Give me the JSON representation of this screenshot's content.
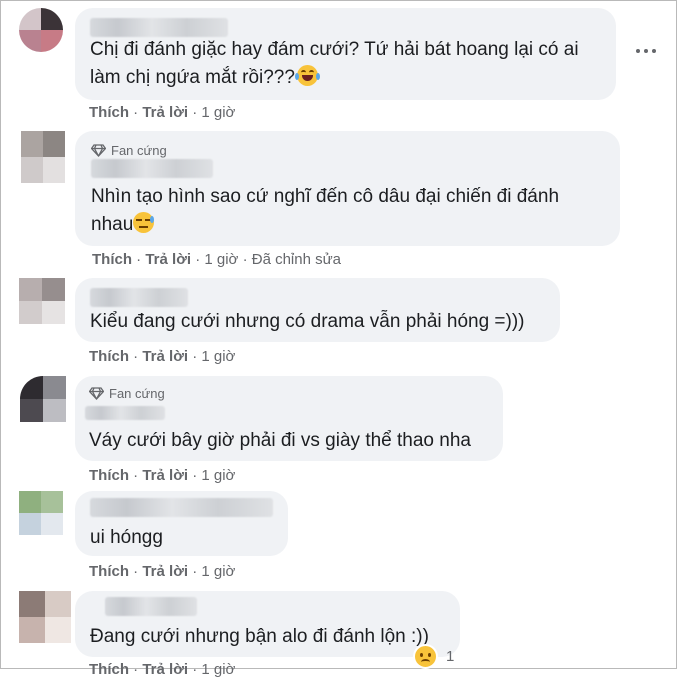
{
  "comments": [
    {
      "text_lines": [
        "Chị đi đánh giặc hay đám cưới? Tứ hải bát hoang lại có ai",
        "làm chị ngứa mắt rồi???"
      ],
      "emoji": "tears-of-joy-emoji",
      "like": "Thích",
      "reply": "Trả lời",
      "time": "1 giờ"
    },
    {
      "badge": "Fan cứng",
      "text_lines": [
        "Nhìn tạo hình sao cứ nghĩ đến cô dâu đại chiến đi đánh",
        "nhau"
      ],
      "emoji": "unamused-face-emoji",
      "like": "Thích",
      "reply": "Trả lời",
      "time": "1 giờ",
      "edited": "Đã chỉnh sửa"
    },
    {
      "text_lines": [
        "Kiểu đang cưới nhưng có drama vẫn phải hóng =)))"
      ],
      "like": "Thích",
      "reply": "Trả lời",
      "time": "1 giờ"
    },
    {
      "badge": "Fan cứng",
      "text_lines": [
        "Váy cưới bây giờ phải đi vs giày thể thao nha"
      ],
      "like": "Thích",
      "reply": "Trả lời",
      "time": "1 giờ"
    },
    {
      "text_lines": [
        "ui hóngg"
      ],
      "like": "Thích",
      "reply": "Trả lời",
      "time": "1 giờ"
    },
    {
      "text_lines": [
        "Đang cưới nhưng bận alo đi đánh lộn :))"
      ],
      "like": "Thích",
      "reply": "Trả lời",
      "time": "1 giờ",
      "reaction_count": "1"
    }
  ],
  "icons": {
    "menu": "more-options-icon",
    "badge": "diamond-icon",
    "reaction": "sad-face-reaction-icon"
  },
  "colors": {
    "bubble": "#f0f2f5",
    "text": "#1c1e21",
    "meta": "#65676b"
  }
}
